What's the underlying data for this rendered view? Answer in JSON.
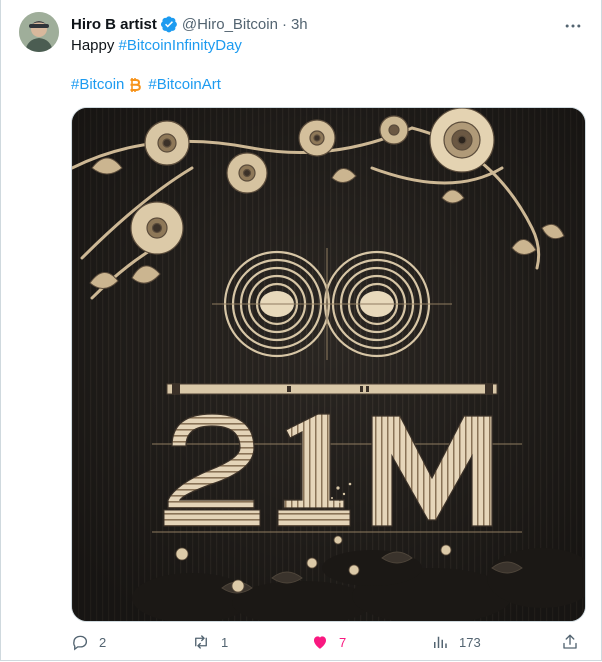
{
  "tweet": {
    "author_name": "Hiro B artist",
    "handle": "@Hiro_Bitcoin",
    "separator": "·",
    "time": "3h",
    "text_prefix": "Happy ",
    "text_hashtag": "#BitcoinInfinityDay",
    "tag_bitcoin": "#Bitcoin",
    "tag_bitcoin_art": "#BitcoinArt",
    "verified": true
  },
  "image": {
    "number_label_1": "2",
    "number_label_2": "1",
    "number_label_3": "M"
  },
  "actions": {
    "replies": "2",
    "reposts": "1",
    "likes": "7",
    "views": "173"
  },
  "icons": {
    "more": "more-icon",
    "reply": "reply-icon",
    "repost": "repost-icon",
    "like": "heart-icon",
    "views": "views-icon",
    "share": "share-icon",
    "verified": "verified-badge-icon",
    "bitcoin": "bitcoin-icon"
  },
  "colors": {
    "accent": "#1d9bf0",
    "like": "#f91880",
    "muted": "#536471",
    "bitcoin": "#f7931a"
  }
}
